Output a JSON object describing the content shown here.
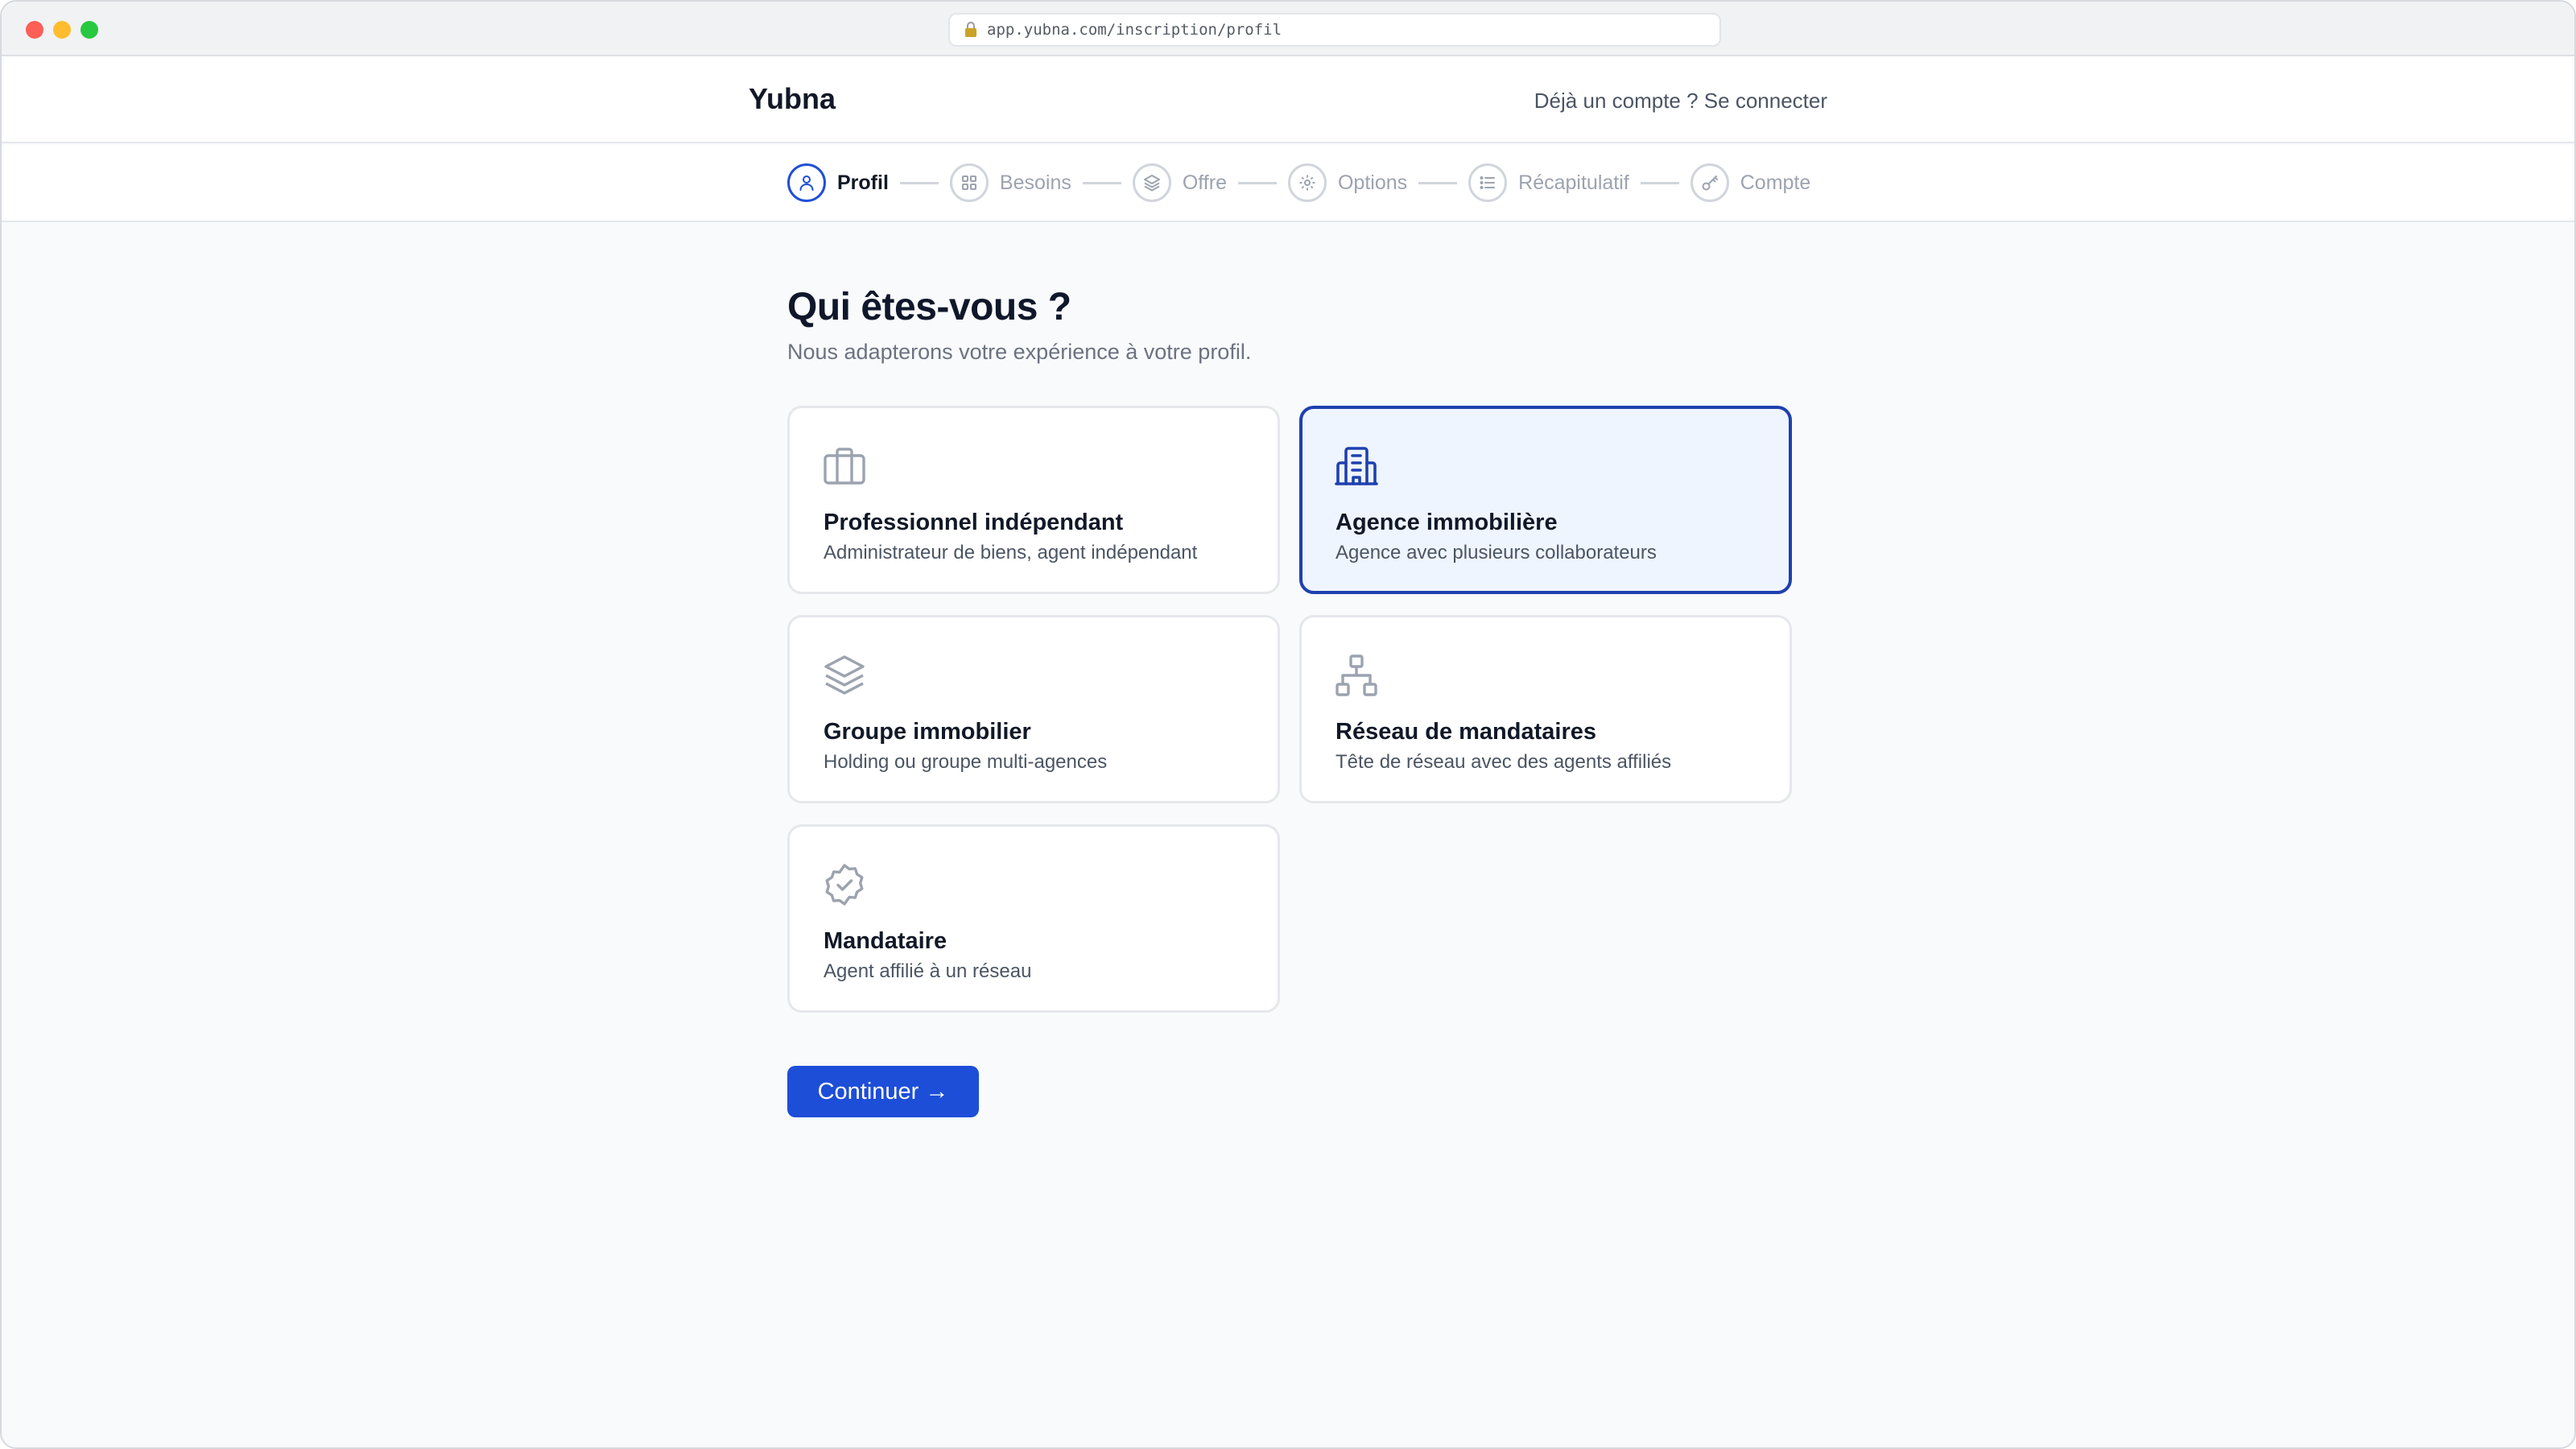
{
  "browser": {
    "url": "app.yubna.com/inscription/profil"
  },
  "header": {
    "logo": "Yubna",
    "login_link": "Déjà un compte ? Se connecter"
  },
  "stepper": {
    "steps": [
      {
        "label": "Profil",
        "icon": "user-icon",
        "active": true
      },
      {
        "label": "Besoins",
        "icon": "grid-icon",
        "active": false
      },
      {
        "label": "Offre",
        "icon": "layers-icon",
        "active": false
      },
      {
        "label": "Options",
        "icon": "gear-icon",
        "active": false
      },
      {
        "label": "Récapitulatif",
        "icon": "list-icon",
        "active": false
      },
      {
        "label": "Compte",
        "icon": "key-icon",
        "active": false
      }
    ]
  },
  "main": {
    "title": "Qui êtes-vous ?",
    "subtitle": "Nous adapterons votre expérience à votre profil.",
    "options": [
      {
        "title": "Professionnel indépendant",
        "description": "Administrateur de biens, agent indépendant",
        "icon": "briefcase-icon",
        "selected": false
      },
      {
        "title": "Agence immobilière",
        "description": "Agence avec plusieurs collaborateurs",
        "icon": "building-icon",
        "selected": true
      },
      {
        "title": "Groupe immobilier",
        "description": "Holding ou groupe multi-agences",
        "icon": "layers-icon",
        "selected": false
      },
      {
        "title": "Réseau de mandataires",
        "description": "Tête de réseau avec des agents affiliés",
        "icon": "network-icon",
        "selected": false
      },
      {
        "title": "Mandataire",
        "description": "Agent affilié à un réseau",
        "icon": "badge-check-icon",
        "selected": false
      }
    ],
    "continue_label": "Continuer →"
  },
  "colors": {
    "accent": "#1d4ed8",
    "selected_border": "#1e40af",
    "selected_bg": "#eef5ff",
    "icon_gray": "#9ca3af"
  }
}
